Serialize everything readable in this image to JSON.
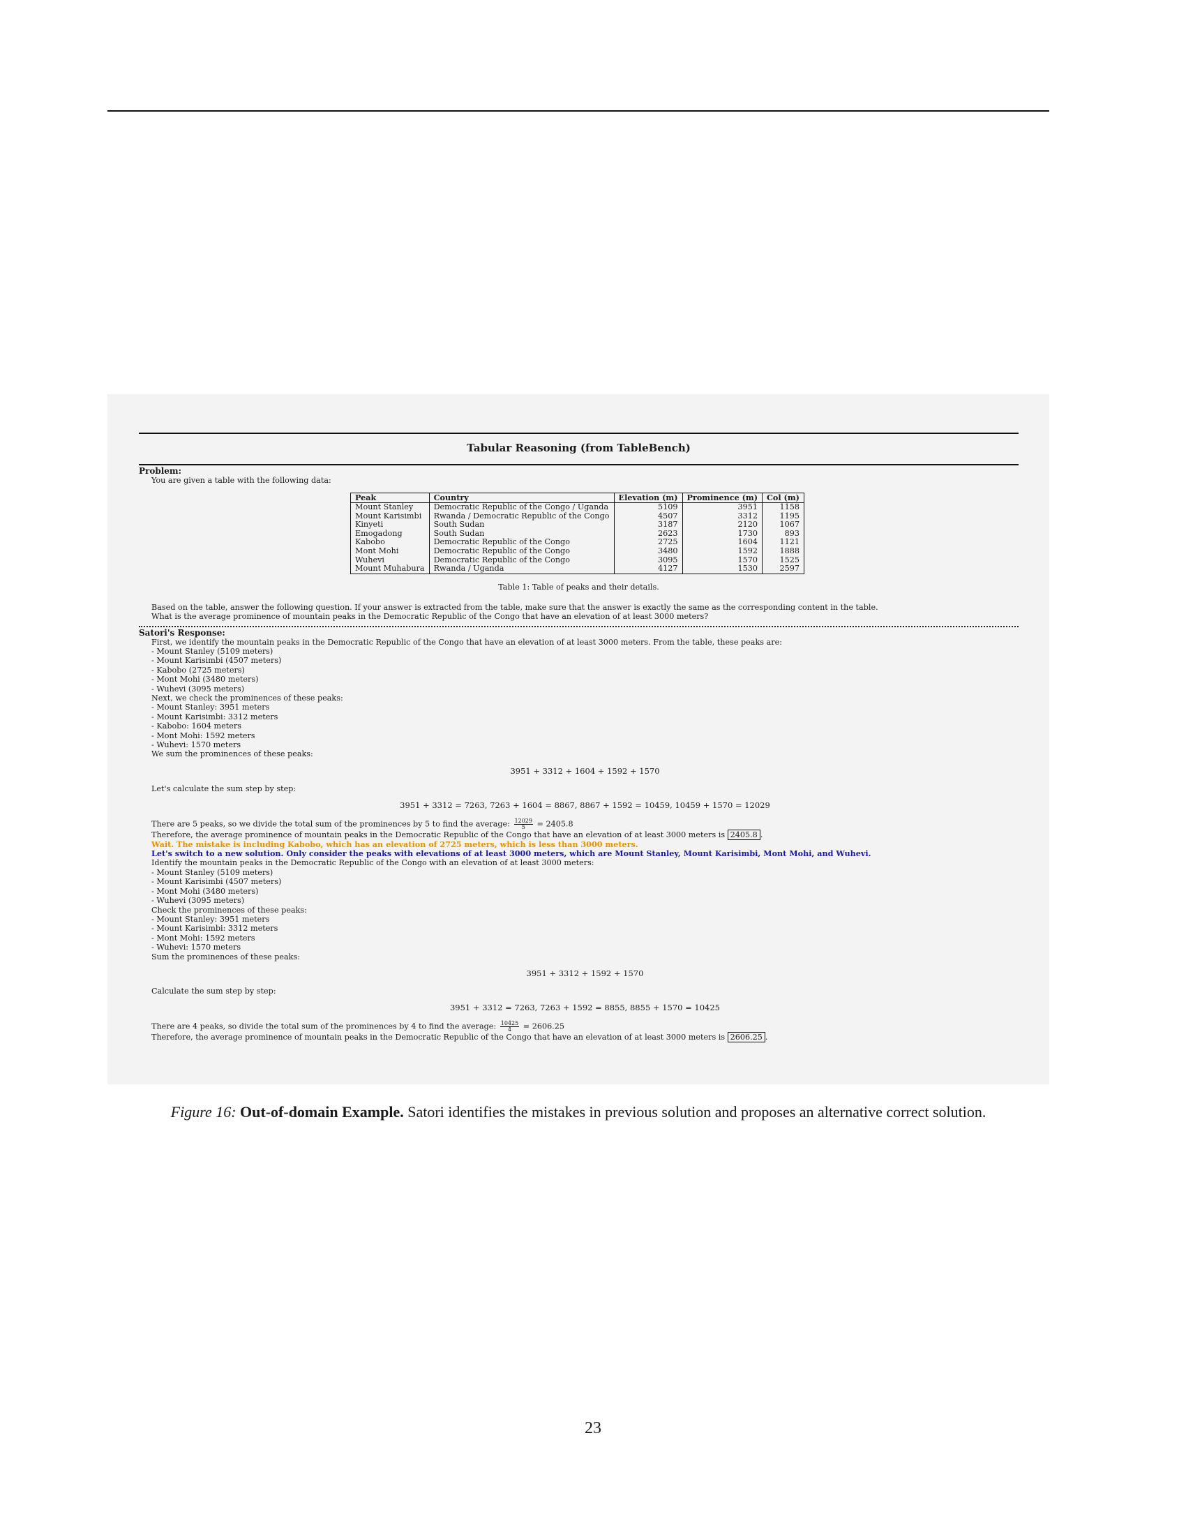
{
  "panel": {
    "title": "Tabular Reasoning (from TableBench)",
    "problem_label": "Problem:",
    "problem_intro": "You are given a table with the following data:",
    "table": {
      "headers": [
        "Peak",
        "Country",
        "Elevation (m)",
        "Prominence (m)",
        "Col (m)"
      ],
      "rows": [
        [
          "Mount Stanley",
          "Democratic Republic of the Congo / Uganda",
          "5109",
          "3951",
          "1158"
        ],
        [
          "Mount Karisimbi",
          "Rwanda / Democratic Republic of the Congo",
          "4507",
          "3312",
          "1195"
        ],
        [
          "Kinyeti",
          "South Sudan",
          "3187",
          "2120",
          "1067"
        ],
        [
          "Emogadong",
          "South Sudan",
          "2623",
          "1730",
          "893"
        ],
        [
          "Kabobo",
          "Democratic Republic of the Congo",
          "2725",
          "1604",
          "1121"
        ],
        [
          "Mont Mohi",
          "Democratic Republic of the Congo",
          "3480",
          "1592",
          "1888"
        ],
        [
          "Wuhevi",
          "Democratic Republic of the Congo",
          "3095",
          "1570",
          "1525"
        ],
        [
          "Mount Muhabura",
          "Rwanda / Uganda",
          "4127",
          "1530",
          "2597"
        ]
      ],
      "caption": "Table 1: Table of peaks and their details."
    },
    "question_instruction": "Based on the table, answer the following question. If your answer is extracted from the table, make sure that the answer is exactly the same as the corresponding content in the table.",
    "question": "What is the average prominence of mountain peaks in the Democratic Republic of the Congo that have an elevation of at least 3000 meters?",
    "response_label": "Satori's Response:",
    "first_pass": {
      "intro": "First, we identify the mountain peaks in the Democratic Republic of the Congo that have an elevation of at least 3000 meters. From the table, these peaks are:",
      "peaks": [
        "- Mount Stanley (5109 meters)",
        "- Mount Karisimbi (4507 meters)",
        "- Kabobo (2725 meters)",
        "- Mont Mohi (3480 meters)",
        "- Wuhevi (3095 meters)"
      ],
      "prom_intro": "Next, we check the prominences of these peaks:",
      "proms": [
        "- Mount Stanley: 3951 meters",
        "- Mount Karisimbi: 3312 meters",
        "- Kabobo: 1604 meters",
        "- Mont Mohi: 1592 meters",
        "- Wuhevi: 1570 meters"
      ],
      "sum_intro": "We sum the prominences of these peaks:",
      "sum_eq": "3951 + 3312 + 1604 + 1592 + 1570",
      "step_intro": "Let's calculate the sum step by step:",
      "step_eq": "3951 + 3312 = 7263, 7263 + 1604 = 8867, 8867 + 1592 = 10459, 10459 + 1570 = 12029",
      "avg_text": "There are 5 peaks, so we divide the total sum of the prominences by 5 to find the average:",
      "avg_num": "12029",
      "avg_den": "5",
      "avg_result": "= 2405.8",
      "conclusion": "Therefore, the average prominence of mountain peaks in the Democratic Republic of the Congo that have an elevation of at least 3000 meters is",
      "answer": "2405.8"
    },
    "wait_text": "Wait. The mistake is including Kabobo, which has an elevation of 2725 meters, which is less than 3000 meters.",
    "switch_text": "Let's switch to a new solution. Only consider the peaks with elevations of at least 3000 meters, which are Mount Stanley, Mount Karisimbi, Mont Mohi, and Wuhevi.",
    "second_pass": {
      "intro": "Identify the mountain peaks in the Democratic Republic of the Congo with an elevation of at least 3000 meters:",
      "peaks": [
        "- Mount Stanley (5109 meters)",
        "- Mount Karisimbi (4507 meters)",
        "- Mont Mohi (3480 meters)",
        "- Wuhevi (3095 meters)"
      ],
      "prom_intro": "Check the prominences of these peaks:",
      "proms": [
        "- Mount Stanley: 3951 meters",
        "- Mount Karisimbi: 3312 meters",
        "- Mont Mohi: 1592 meters",
        "- Wuhevi: 1570 meters"
      ],
      "sum_intro": "Sum the prominences of these peaks:",
      "sum_eq": "3951 + 3312 + 1592 + 1570",
      "step_intro": "Calculate the sum step by step:",
      "step_eq": "3951 + 3312 = 7263, 7263 + 1592 = 8855, 8855 + 1570 = 10425",
      "avg_text": "There are 4 peaks, so divide the total sum of the prominences by 4 to find the average:",
      "avg_num": "10425",
      "avg_den": "4",
      "avg_result": "= 2606.25",
      "conclusion": "Therefore, the average prominence of mountain peaks in the Democratic Republic of the Congo that have an elevation of at least 3000 meters is",
      "answer": "2606.25"
    }
  },
  "figure_caption": {
    "label": "Figure 16:",
    "bold": "Out-of-domain Example.",
    "text": "Satori identifies the mistakes in previous solution and proposes an alternative correct solution."
  },
  "page_number": "23"
}
